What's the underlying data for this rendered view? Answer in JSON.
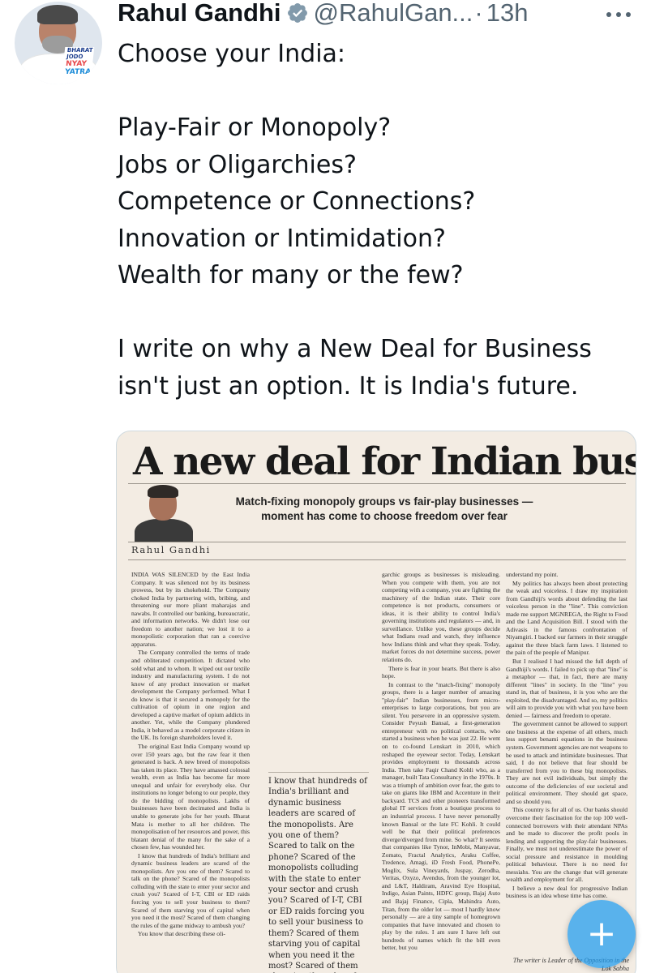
{
  "author": {
    "display_name": "Rahul Gandhi",
    "handle": "@RahulGan...",
    "separator": "·",
    "time": "13h",
    "avatar_badge": [
      "BHARAT",
      "JODO",
      "NYAY",
      "YATRA"
    ]
  },
  "icons": {
    "verified": "verified-badge-icon",
    "more": "more-options-icon",
    "compose": "compose-plus-icon"
  },
  "colors": {
    "text": "#0f1419",
    "secondary": "#536471",
    "accent": "#1d9bf0",
    "verified_badge": "#829aab"
  },
  "tweet": {
    "lines": [
      "Choose your India:",
      "",
      "Play-Fair or Monopoly?",
      "Jobs or Oligarchies?",
      "Competence or Connections?",
      "Innovation or Intimidation?",
      "Wealth for many or the few?",
      "",
      "I write on why a New Deal for Business",
      "isn't just an option. It is India's future."
    ]
  },
  "article": {
    "headline": "A new deal for Indian business",
    "subhead": "Match-fixing monopoly groups vs fair-play businesses — moment has come to choose freedom over fear",
    "byline": "Rahul Gandhi",
    "column1": [
      "INDIA WAS SILENCED by the East India Company. It was silenced not by its business prowess, but by its chokehold. The Company choked India by partnering with, bribing, and threatening our more pliant maharajas and nawabs. It controlled our banking, bureaucratic, and information networks. We didn't lose our freedom to another nation; we lost it to a monopolistic corporation that ran a coercive apparatus.",
      "The Company controlled the terms of trade and obliterated competition. It dictated who sold what and to whom. It wiped out our textile industry and manufacturing system. I do not know of any product innovation or market development the Company performed. What I do know is that it secured a monopoly for the cultivation of opium in one region and developed a captive market of opium addicts in another. Yet, while the Company plundered India, it behaved as a model corporate citizen in the UK. Its foreign shareholders loved it.",
      "The original East India Company wound up over 150 years ago, but the raw fear it then generated is back. A new breed of monopolists has taken its place. They have amassed colossal wealth, even as India has become far more unequal and unfair for everybody else. Our institutions no longer belong to our people, they do the bidding of monopolists. Lakhs of businesses have been decimated and India is unable to generate jobs for her youth. Bharat Mata is mother to all her children. The monopolisation of her resources and power, this blatant denial of the many for the sake of a chosen few, has wounded her.",
      "I know that hundreds of India's brilliant and dynamic business leaders are scared of the monopolists. Are you one of them? Scared to talk on the phone? Scared of the monopolists colluding with the state to enter your sector and crush you? Scared of I-T, CBI or ED raids forcing you to sell your business to them? Scared of them starving you of capital when you need it the most? Scared of them changing the rules of the game midway to ambush you?",
      "You know that describing these oli-"
    ],
    "pull_quote": "I know that hundreds of India's brilliant and dynamic business leaders are scared of the monopolists. Are you one of them? Scared to talk on the phone? Scared of the monopolists colluding with the state to enter your sector and crush you? Scared of I-T, CBI or ED raids forcing you to sell your business to them? Scared of them starving you of capital when you need it the most? Scared of them changing the rules of the game midway to ambush you?",
    "column3": [
      "garchic groups as businesses is misleading. When you compete with them, you are not competing with a company, you are fighting the machinery of the Indian state. Their core competence is not products, consumers or ideas, it is their ability to control India's governing institutions and regulators — and, in surveillance. Unlike you, these groups decide what Indians read and watch, they influence how Indians think and what they speak. Today, market forces do not determine success, power relations do.",
      "There is fear in your hearts. But there is also hope.",
      "In contrast to the \"match-fixing\" monopoly groups, there is a larger number of amazing \"play-fair\" Indian businesses, from micro-enterprises to large corporations, but you are silent. You persevere in an oppressive system. Consider Peyush Bansal, a first-generation entrepreneur with no political contacts, who started a business when he was just 22. He went on to co-found Lenskart in 2010, which reshaped the eyewear sector. Today, Lenskart provides employment to thousands across India. Then take Faqir Chand Kohli who, as a manager, built Tata Consultancy in the 1970s. It was a triumph of ambition over fear, the guts to take on giants like IBM and Accenture in their backyard. TCS and other pioneers transformed global IT services from a boutique process to an industrial process. I have never personally known Bansal or the late FC Kohli. It could well be that their political preferences diverge/diverged from mine. So what? It seems that companies like Tynor, InMobi, Manyavar, Zomato, Fractal Analytics, Araku Coffee, Tredence, Amagi, iD Fresh Food, PhonePe, Moglix, Sula Vineyards, Juspay, Zerodha, Veritas, Oxyzo, Avendus, from the younger lot, and L&T, Haldiram, Aravind Eye Hospital, Indigo, Asian Paints, HDFC group, Bajaj Auto and Bajaj Finance, Cipla, Mahindra Auto, Titan, from the older lot — most I hardly know personally — are a tiny sample of homegrown companies that have innovated and chosen to play by the rules. I am sure I have left out hundreds of names which fit the bill even better, but you"
    ],
    "column4": [
      "understand my point.",
      "My politics has always been about protecting the weak and voiceless. I draw my inspiration from Gandhiji's words about defending the last voiceless person in the \"line\". This conviction made me support MGNREGA, the Right to Food and the Land Acquisition Bill. I stood with the Adivasis in the famous confrontation of Niyamgiri. I backed our farmers in their struggle against the three black farm laws. I listened to the pain of the people of Manipur.",
      "But I realised I had missed the full depth of Gandhiji's words. I failed to pick up that \"line\" is a metaphor — that, in fact, there are many different \"lines\" in society. In the \"line\" you stand in, that of business, it is you who are the exploited, the disadvantaged. And so, my politics will aim to provide you with what you have been denied — fairness and freedom to operate.",
      "The government cannot be allowed to support one business at the expense of all others, much less support benami equations in the business system. Government agencies are not weapons to be used to attack and intimidate businesses. That said, I do not believe that fear should be transferred from you to these big monopolists. They are not evil individuals, but simply the outcome of the deficiencies of our societal and political environment. They should get space, and so should you.",
      "This country is for all of us. Our banks should overcome their fascination for the top 100 well-connected borrowers with their attendant NPAs and be made to discover the profit pools in lending and supporting the play-fair businesses. Finally, we must not underestimate the power of social pressure and resistance in moulding political behaviour. There is no need for messiahs. You are the change that will generate wealth and employment for all.",
      "I believe a new deal for progressive Indian business is an idea whose time has come."
    ],
    "footnote": "The writer is Leader of the Opposition in the Lok Sabha"
  }
}
